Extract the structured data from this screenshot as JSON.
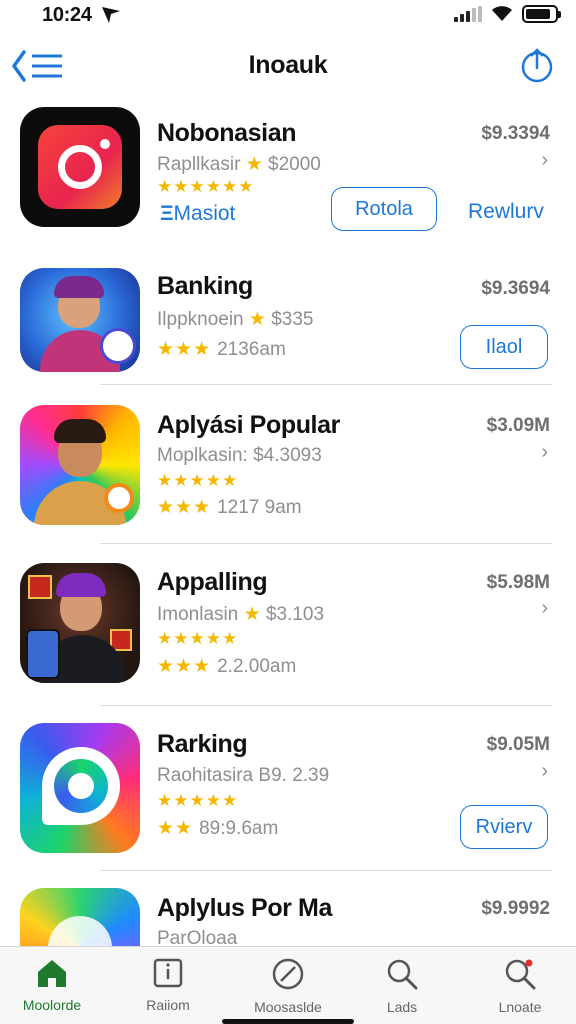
{
  "status_bar": {
    "time": "10:24",
    "battery_level": 0.85
  },
  "nav": {
    "title": "Inoauk",
    "back_icon": "back-list-icon",
    "share_icon": "share-icon"
  },
  "apps": [
    {
      "name": "Nobonasian",
      "price": "$9.3394",
      "subtitle_prefix": "Rapllkasir",
      "subtitle_value": "$2000",
      "stars_line": "★★★★★★",
      "link_label": "Masiot",
      "button_label": "Rotola",
      "action_label": "Rewlurv"
    },
    {
      "name": "Banking",
      "price": "$9.3694",
      "subtitle_prefix": "Ilppknoein",
      "subtitle_value": "$335",
      "meta_stars": "★★★",
      "meta_text": "2136am",
      "button_label": "Ilaol"
    },
    {
      "name": "Aplyási Popular",
      "price": "$3.09M",
      "subtitle_prefix": "Moplkasin:",
      "subtitle_value": "$4.3093",
      "stars_line": "★★★★★",
      "meta_stars": "★★★",
      "meta_text": "1217 9am"
    },
    {
      "name": "Appalling",
      "price": "$5.98M",
      "subtitle_prefix": "Imonlasin",
      "subtitle_value": "$3.103",
      "stars_line": "★★★★★",
      "meta_stars": "★★★",
      "meta_text": "2.2.00am"
    },
    {
      "name": "Rarking",
      "price": "$9.05M",
      "subtitle_prefix": "Raohitasira",
      "subtitle_value": "B9. 2.39",
      "stars_line": "★★★★★",
      "meta_stars": "★★",
      "meta_text": "89:9.6am",
      "button_label": "Rvierv"
    },
    {
      "name": "Aplylus Por Ma",
      "price": "$9.9992",
      "subtitle_prefix": "ParOloaa",
      "subtitle_value": ""
    }
  ],
  "tabs": [
    {
      "label": "Moolorde",
      "icon": "home-icon",
      "active": true
    },
    {
      "label": "Raiiom",
      "icon": "info-square-icon",
      "active": false
    },
    {
      "label": "Moosaslde",
      "icon": "compass-icon",
      "active": false
    },
    {
      "label": "Lads",
      "icon": "search-icon",
      "active": false
    },
    {
      "label": "Lnoate",
      "icon": "search-badge-icon",
      "active": false
    }
  ],
  "colors": {
    "accent": "#1d78d7",
    "star": "#f3b800",
    "active_tab": "#1f7a2e"
  }
}
